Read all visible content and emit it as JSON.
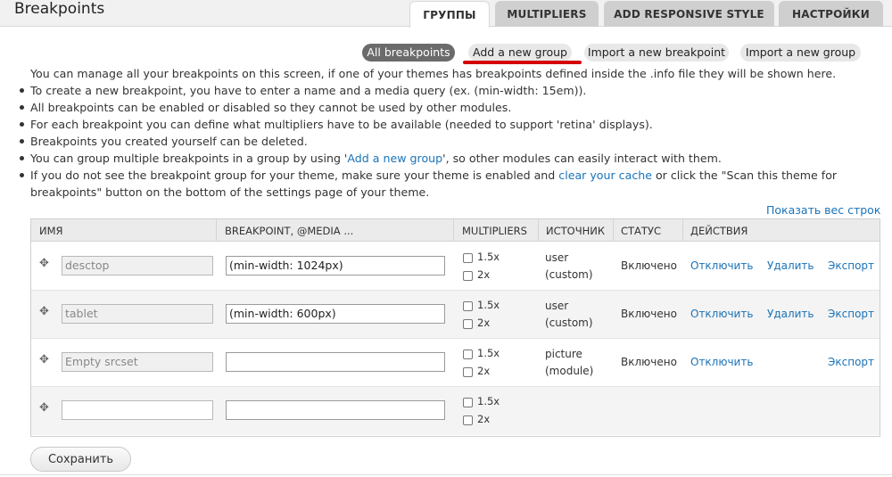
{
  "header": {
    "title": "Breakpoints",
    "tabs": [
      {
        "label": "ГРУППЫ",
        "active": true
      },
      {
        "label": "MULTIPLIERS",
        "active": false
      },
      {
        "label": "ADD RESPONSIVE STYLE",
        "active": false
      },
      {
        "label": "НАСТРОЙКИ",
        "active": false
      }
    ]
  },
  "subnav": {
    "items": [
      {
        "label": "All breakpoints",
        "active": true
      },
      {
        "label": "Add a new group",
        "active": false
      },
      {
        "label": "Import a new breakpoint",
        "active": false
      },
      {
        "label": "Import a new group",
        "active": false
      }
    ]
  },
  "help": {
    "intro": "You can manage all your breakpoints on this screen, if one of your themes has breakpoints defined inside the .info file they will be shown here.",
    "b1": "To create a new breakpoint, you have to enter a name and a media query (ex. (min-width: 15em)).",
    "b2": "All breakpoints can be enabled or disabled so they cannot be used by other modules.",
    "b3": "For each breakpoint you can define what multipliers have to be available (needed to support 'retina' displays).",
    "b4": "Breakpoints you created yourself can be deleted.",
    "b5_pre": "You can group multiple breakpoints in a group by using '",
    "b5_link": "Add a new group",
    "b5_post": "', so other modules can easily interact with them.",
    "b6_pre": "If you do not see the breakpoint group for your theme, make sure your theme is enabled and ",
    "b6_link": "clear your cache",
    "b6_mid": " or click the \"Scan this theme for",
    "b6_line2": "breakpoints\" button on the bottom of the settings page of your theme."
  },
  "show_weights": "Показать вес строк",
  "table": {
    "headers": {
      "name": "ИМЯ",
      "breakpoint": "BREAKPOINT, @MEDIA ...",
      "multipliers": "MULTIPLIERS",
      "source": "ИСТОЧНИК",
      "status": "СТАТУС",
      "actions": "ДЕЙСТВИЯ"
    },
    "multiplier_options": [
      "1.5x",
      "2x"
    ],
    "rows": [
      {
        "name": "desctop",
        "breakpoint": "(min-width: 1024px)",
        "source1": "user",
        "source2": "(custom)",
        "status": "Включено",
        "disable": "Отключить",
        "delete": "Удалить",
        "export": "Экспорт"
      },
      {
        "name": "tablet",
        "breakpoint": "(min-width: 600px)",
        "source1": "user",
        "source2": "(custom)",
        "status": "Включено",
        "disable": "Отключить",
        "delete": "Удалить",
        "export": "Экспорт"
      },
      {
        "name_placeholder": "Empty srcset",
        "breakpoint": "",
        "source1": "picture",
        "source2": "(module)",
        "status": "Включено",
        "disable": "Отключить",
        "export": "Экспорт"
      },
      {
        "name": "",
        "breakpoint": ""
      }
    ]
  },
  "save_label": "Сохранить",
  "colors": {
    "link": "#1a73b8",
    "accent_underline": "#d40000",
    "active_pill": "#6b6b6b"
  }
}
